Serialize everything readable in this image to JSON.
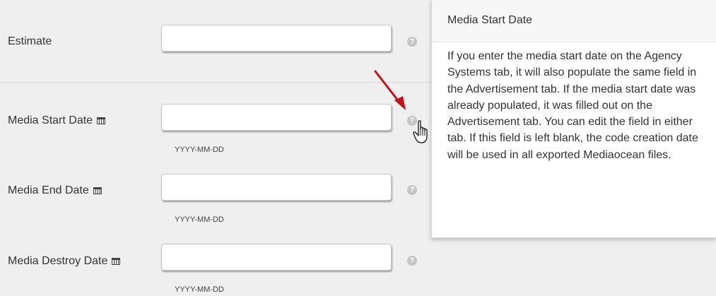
{
  "fields": [
    {
      "label": "Estimate",
      "value": "",
      "has_calendar": false,
      "hint": ""
    },
    {
      "label": "Media Start Date",
      "value": "",
      "has_calendar": true,
      "hint": "YYYY-MM-DD"
    },
    {
      "label": "Media End Date",
      "value": "",
      "has_calendar": true,
      "hint": "YYYY-MM-DD"
    },
    {
      "label": "Media Destroy Date",
      "value": "",
      "has_calendar": true,
      "hint": "YYYY-MM-DD"
    }
  ],
  "help_icon": {
    "glyph": "?",
    "icon": "question-circle-icon"
  },
  "popover": {
    "title": "Media Start Date",
    "body": "If you enter the media start date on the Agency Systems tab, it will also populate the same field in the Advertisement tab. If the media start date was already populated, it was filled out on the Advertisement tab. You can edit the field in either tab. If this field is left blank, the code creation date will be used in all exported Mediaocean files."
  },
  "annotations": {
    "arrow_color": "#c0151b"
  },
  "icons": {
    "calendar": "calendar-icon",
    "cursor": "hand-pointer-icon",
    "arrow": "red-arrow-icon"
  }
}
